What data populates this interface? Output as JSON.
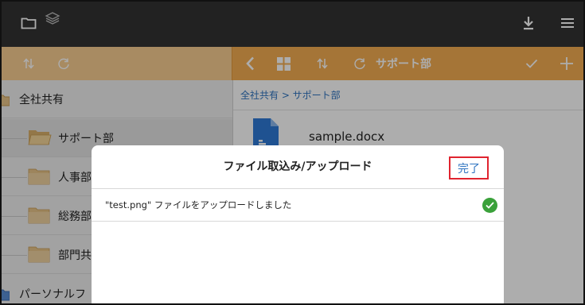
{
  "topbar": {
    "icons": [
      "folder-icon",
      "layers-icon",
      "download-icon",
      "menu-icon"
    ]
  },
  "toolbar": {
    "left_icons": [
      "sort-icon",
      "refresh-icon"
    ],
    "right_icons": [
      "back-icon",
      "grid-view-icon",
      "sort-icon",
      "refresh-icon",
      "check-icon",
      "add-icon"
    ],
    "title": "サポート部"
  },
  "sidebar": {
    "items": [
      {
        "label": "全社共有",
        "level": 0
      },
      {
        "label": "サポート部",
        "level": 1,
        "selected": true
      },
      {
        "label": "人事部",
        "level": 1
      },
      {
        "label": "総務部",
        "level": 1
      },
      {
        "label": "部門共",
        "level": 1
      },
      {
        "label": "パーソナルフ",
        "level": 0
      }
    ]
  },
  "main": {
    "breadcrumb": "全社共有 > サポート部",
    "files": [
      {
        "name": "sample.docx",
        "icon": "document-icon"
      }
    ]
  },
  "dialog": {
    "title": "ファイル取込み/アップロード",
    "done_label": "完了",
    "message": "\"test.png\" ファイルをアップロードしました",
    "status_icon": "success-check-icon"
  },
  "colors": {
    "topbar": "#333333",
    "toolbar_orange": "#f3ad52",
    "toolbar_light": "#f8cd91",
    "link_blue": "#2f74c0",
    "highlight_red": "#e0242f",
    "success_green": "#3aa13a",
    "folder_tan": "#e8c58a"
  }
}
